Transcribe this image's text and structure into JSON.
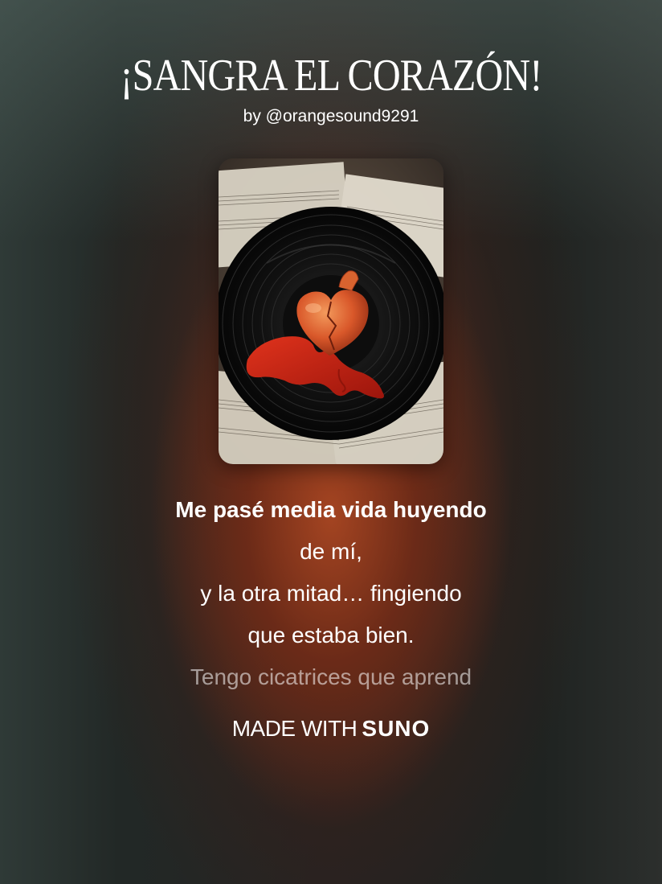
{
  "song": {
    "title": "¡SANGRA EL CORAZÓN!",
    "byline": "by @orangesound9291"
  },
  "cover_art": {
    "description_icon": "vinyl-record-with-bleeding-heart-icon"
  },
  "lyrics": [
    {
      "text": "Me pasé media vida huyendo",
      "state": "active"
    },
    {
      "text": "de mí,",
      "state": "normal"
    },
    {
      "text": "y la otra mitad… fingiendo",
      "state": "normal"
    },
    {
      "text": "que estaba bien.",
      "state": "normal"
    },
    {
      "text": "Tengo cicatrices que aprend",
      "state": "faded"
    }
  ],
  "footer": {
    "made_with_label": "MADE WITH",
    "brand": "SUNO"
  },
  "colors": {
    "accent_glow": "#a84622",
    "background_dark": "#222826",
    "text": "#ffffff"
  }
}
